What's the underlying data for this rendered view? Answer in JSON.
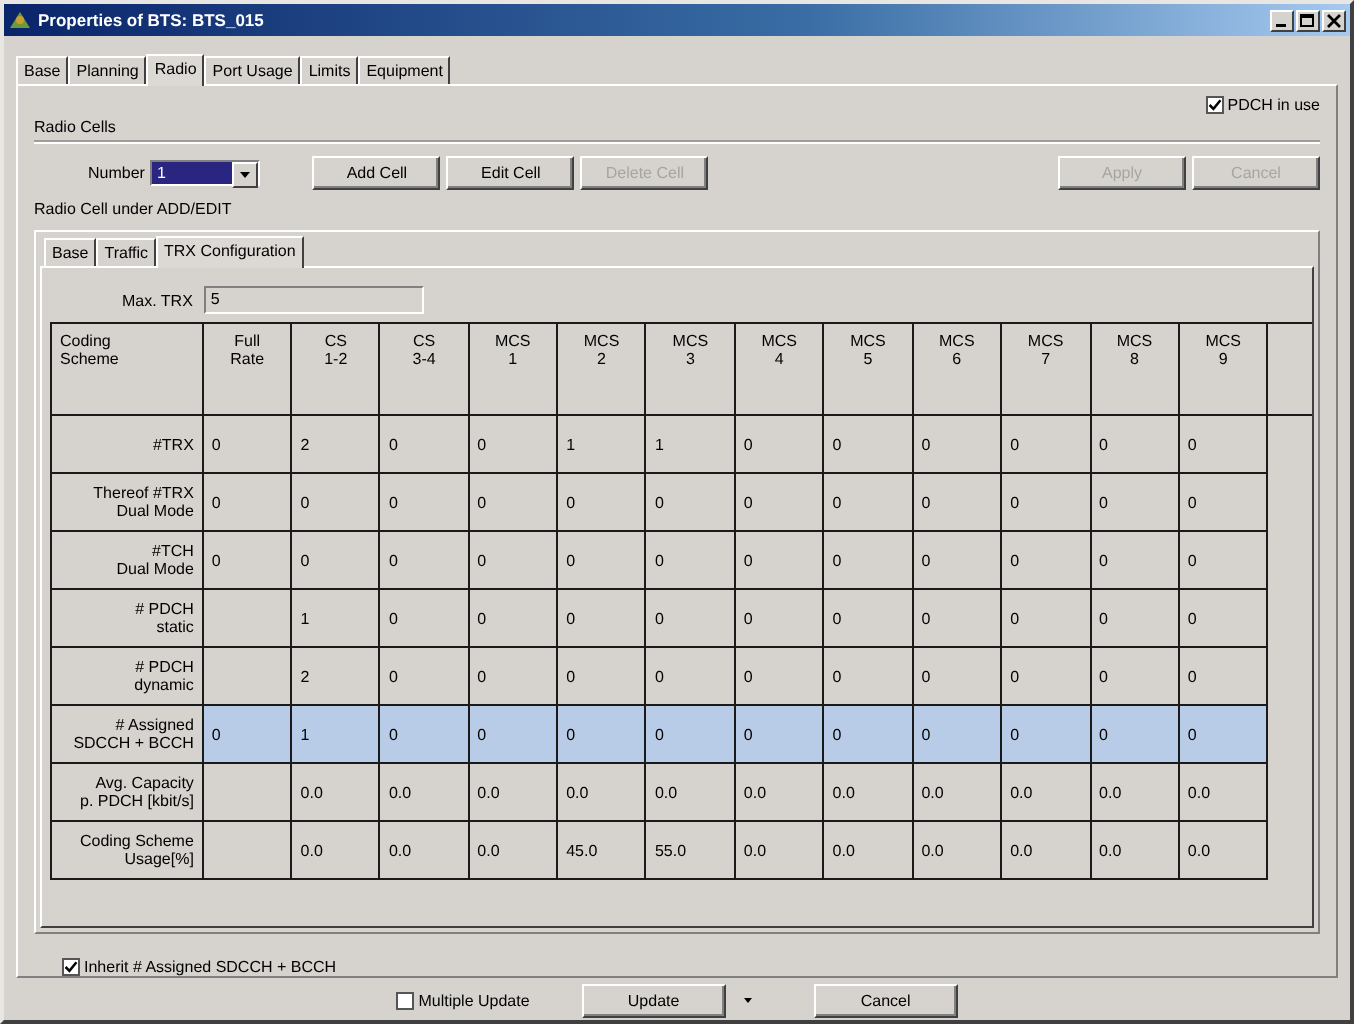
{
  "window": {
    "title": "Properties of BTS: BTS_015"
  },
  "tabs": [
    {
      "label": "Base",
      "selected": false
    },
    {
      "label": "Planning",
      "selected": false
    },
    {
      "label": "Radio",
      "selected": true
    },
    {
      "label": "Port Usage",
      "selected": false
    },
    {
      "label": "Limits",
      "selected": false
    },
    {
      "label": "Equipment",
      "selected": false
    }
  ],
  "pdch_in_use": {
    "label": "PDCH in use",
    "checked": true
  },
  "radio_cells": {
    "title": "Radio Cells",
    "number_label": "Number",
    "number_value": "1",
    "buttons": [
      {
        "label": "Add Cell",
        "disabled": false
      },
      {
        "label": "Edit Cell",
        "disabled": false
      },
      {
        "label": "Delete Cell",
        "disabled": true
      }
    ],
    "actions": [
      {
        "label": "Apply",
        "disabled": true
      },
      {
        "label": "Cancel",
        "disabled": true
      }
    ]
  },
  "edit_group": {
    "title": "Radio Cell under ADD/EDIT",
    "tabs": [
      {
        "label": "Base",
        "selected": false
      },
      {
        "label": "Traffic",
        "selected": false
      },
      {
        "label": "TRX Configuration",
        "selected": true
      }
    ],
    "max_trx": {
      "label": "Max. TRX",
      "value": "5"
    },
    "table": {
      "corner": {
        "lines": [
          "Coding",
          "Scheme"
        ]
      },
      "columns": [
        {
          "lines": [
            "Full",
            "Rate"
          ]
        },
        {
          "lines": [
            "CS",
            "1-2"
          ]
        },
        {
          "lines": [
            "CS",
            "3-4"
          ]
        },
        {
          "lines": [
            "MCS",
            "1"
          ]
        },
        {
          "lines": [
            "MCS",
            "2"
          ]
        },
        {
          "lines": [
            "MCS",
            "3"
          ]
        },
        {
          "lines": [
            "MCS",
            "4"
          ]
        },
        {
          "lines": [
            "MCS",
            "5"
          ]
        },
        {
          "lines": [
            "MCS",
            "6"
          ]
        },
        {
          "lines": [
            "MCS",
            "7"
          ]
        },
        {
          "lines": [
            "MCS",
            "8"
          ]
        },
        {
          "lines": [
            "MCS",
            "9"
          ]
        }
      ],
      "rows": [
        {
          "lines": [
            "#TRX"
          ],
          "selected": false,
          "cells": [
            "0",
            "2",
            "0",
            "0",
            "1",
            "1",
            "0",
            "0",
            "0",
            "0",
            "0",
            "0"
          ]
        },
        {
          "lines": [
            "Thereof #TRX",
            "Dual Mode"
          ],
          "selected": false,
          "cells": [
            "0",
            "0",
            "0",
            "0",
            "0",
            "0",
            "0",
            "0",
            "0",
            "0",
            "0",
            "0"
          ]
        },
        {
          "lines": [
            "#TCH",
            "Dual Mode"
          ],
          "selected": false,
          "cells": [
            "0",
            "0",
            "0",
            "0",
            "0",
            "0",
            "0",
            "0",
            "0",
            "0",
            "0",
            "0"
          ]
        },
        {
          "lines": [
            "# PDCH",
            "static"
          ],
          "selected": false,
          "cells": [
            null,
            "1",
            "0",
            "0",
            "0",
            "0",
            "0",
            "0",
            "0",
            "0",
            "0",
            "0"
          ]
        },
        {
          "lines": [
            "# PDCH",
            "dynamic"
          ],
          "selected": false,
          "cells": [
            null,
            "2",
            "0",
            "0",
            "0",
            "0",
            "0",
            "0",
            "0",
            "0",
            "0",
            "0"
          ]
        },
        {
          "lines": [
            "# Assigned",
            "SDCCH + BCCH"
          ],
          "selected": true,
          "cells": [
            "0",
            "1",
            "0",
            "0",
            "0",
            "0",
            "0",
            "0",
            "0",
            "0",
            "0",
            "0"
          ]
        },
        {
          "lines": [
            "Avg. Capacity",
            "p. PDCH [kbit/s]"
          ],
          "selected": false,
          "cells": [
            null,
            "0.0",
            "0.0",
            "0.0",
            "0.0",
            "0.0",
            "0.0",
            "0.0",
            "0.0",
            "0.0",
            "0.0",
            "0.0"
          ]
        },
        {
          "lines": [
            "Coding Scheme",
            "Usage[%]"
          ],
          "selected": false,
          "cells": [
            null,
            "0.0",
            "0.0",
            "0.0",
            "45.0",
            "55.0",
            "0.0",
            "0.0",
            "0.0",
            "0.0",
            "0.0",
            "0.0"
          ]
        }
      ]
    },
    "inherit": {
      "label": "Inherit # Assigned SDCCH + BCCH",
      "checked": true
    }
  },
  "footer": {
    "multiple_update": {
      "label": "Multiple Update",
      "checked": false
    },
    "update": {
      "label": "Update"
    },
    "cancel": {
      "label": "Cancel"
    }
  }
}
